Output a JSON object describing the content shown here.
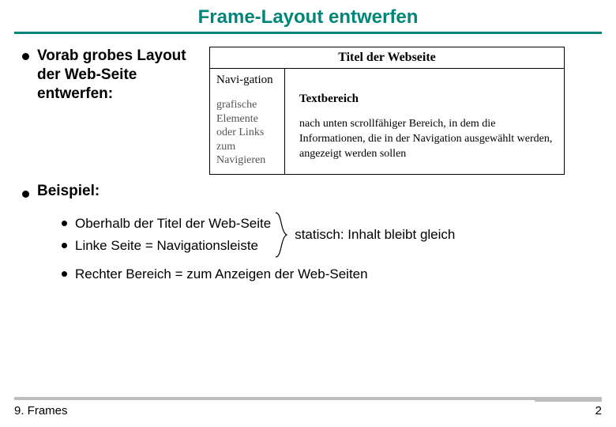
{
  "title": "Frame-Layout entwerfen",
  "bullet1": "Vorab grobes Layout der Web-Seite entwerfen:",
  "diagram": {
    "title": "Titel der Webseite",
    "nav_label": "Navi-gation",
    "nav_desc": "grafische Elemente oder Links zum Navigieren",
    "main_label": "Textbereich",
    "main_desc": "nach unten scrollfähiger Bereich, in dem die Informationen, die in der Navigation ausgewählt werden, angezeigt werden sollen"
  },
  "bullet2": "Beispiel:",
  "sub": {
    "a": "Oberhalb der Titel der Web-Seite",
    "b": "Linke Seite = Navigationsleiste",
    "static": "statisch: Inhalt bleibt gleich",
    "c": "Rechter Bereich = zum Anzeigen der Web-Seiten"
  },
  "footer": {
    "left": "9. Frames",
    "right": "2"
  }
}
